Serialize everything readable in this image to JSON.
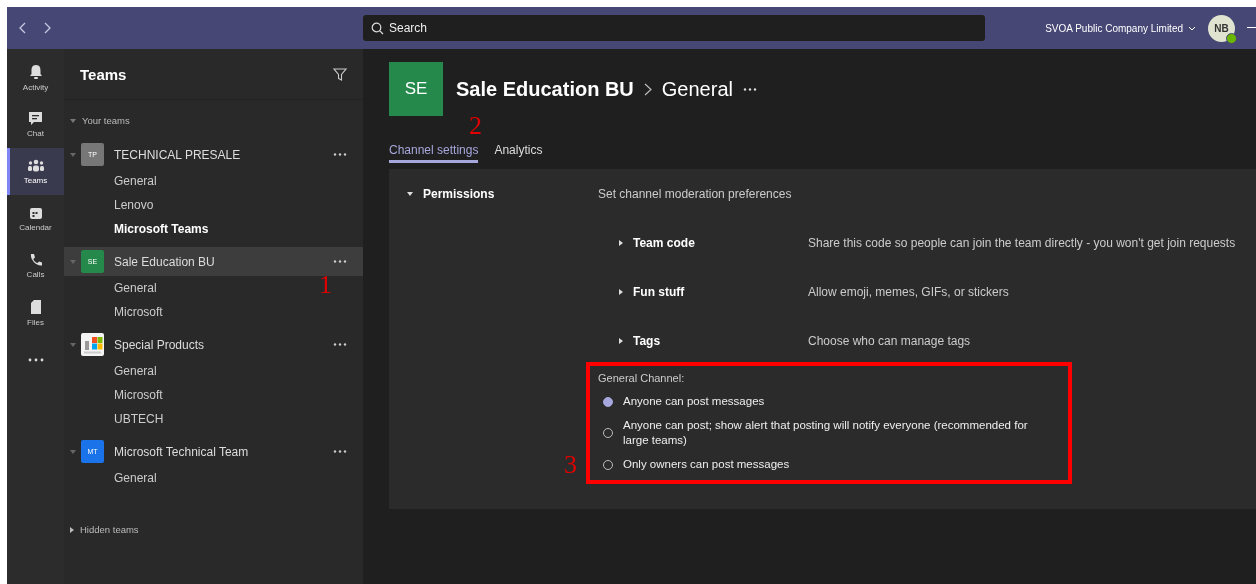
{
  "top_bar": {
    "search_placeholder": "Search",
    "org": "SVOA Public Company Limited",
    "avatar": "NB",
    "online": true
  },
  "rail": [
    {
      "label": "Activity",
      "kind": "bell",
      "selected": false
    },
    {
      "label": "Chat",
      "kind": "chat",
      "selected": false
    },
    {
      "label": "Teams",
      "kind": "teams",
      "selected": true
    },
    {
      "label": "Calendar",
      "kind": "calendar",
      "selected": false
    },
    {
      "label": "Calls",
      "kind": "phone",
      "selected": false
    },
    {
      "label": "Files",
      "kind": "file",
      "selected": false
    },
    {
      "kind": "more",
      "selected": false
    }
  ],
  "sidebar": {
    "title": "Teams",
    "section": "Your teams",
    "teams": [
      {
        "name": "TECHNICAL PRESALE",
        "kind": "initials",
        "initials": "TP",
        "color": "#777777",
        "selected": false,
        "channels": [
          {
            "name": "General",
            "bold": false
          },
          {
            "name": "Lenovo",
            "bold": false
          },
          {
            "name": "Microsoft Teams",
            "bold": true
          }
        ]
      },
      {
        "name": "Sale Education BU",
        "kind": "initials",
        "initials": "SE",
        "color": "#25894b",
        "selected": true,
        "channels": [
          {
            "name": "General",
            "bold": false,
            "marker": "1"
          },
          {
            "name": "Microsoft",
            "bold": false
          }
        ]
      },
      {
        "name": "Special Products",
        "kind": "picture",
        "selected": false,
        "channels": [
          {
            "name": "General",
            "bold": false
          },
          {
            "name": "Microsoft",
            "bold": false
          },
          {
            "name": "UBTECH",
            "bold": false
          }
        ]
      },
      {
        "name": "Microsoft Technical Team",
        "kind": "initials",
        "initials": "MT",
        "color": "#1a73e8",
        "selected": false,
        "channels": [
          {
            "name": "General",
            "bold": false
          }
        ]
      }
    ],
    "hidden": "Hidden teams"
  },
  "header": {
    "initials": "SE",
    "team": "Sale Education BU",
    "channel": "General"
  },
  "tabs": [
    {
      "label": "Channel settings",
      "selected": true,
      "marker": "2"
    },
    {
      "label": "Analytics",
      "selected": false
    }
  ],
  "permissions": {
    "title": "Permissions",
    "description": "Set channel moderation preferences",
    "expanded": true,
    "settings": [
      {
        "title": "Team code",
        "description": "Share this code so people can join the team directly - you won't get join requests",
        "expanded": false
      },
      {
        "title": "Fun stuff",
        "description": "Allow emoji, memes, GIFs, or stickers",
        "expanded": false
      },
      {
        "title": "Tags",
        "description": "Choose who can manage tags",
        "expanded": false
      }
    ],
    "general_channel": {
      "label": "General Channel:",
      "highlighted": true,
      "marker": "3",
      "options": [
        {
          "label": "Anyone can post messages",
          "selected": true
        },
        {
          "label": "Anyone can post; show alert that posting will notify everyone (recommended for large teams)",
          "selected": false
        },
        {
          "label": "Only owners can post messages",
          "selected": false
        }
      ]
    }
  }
}
